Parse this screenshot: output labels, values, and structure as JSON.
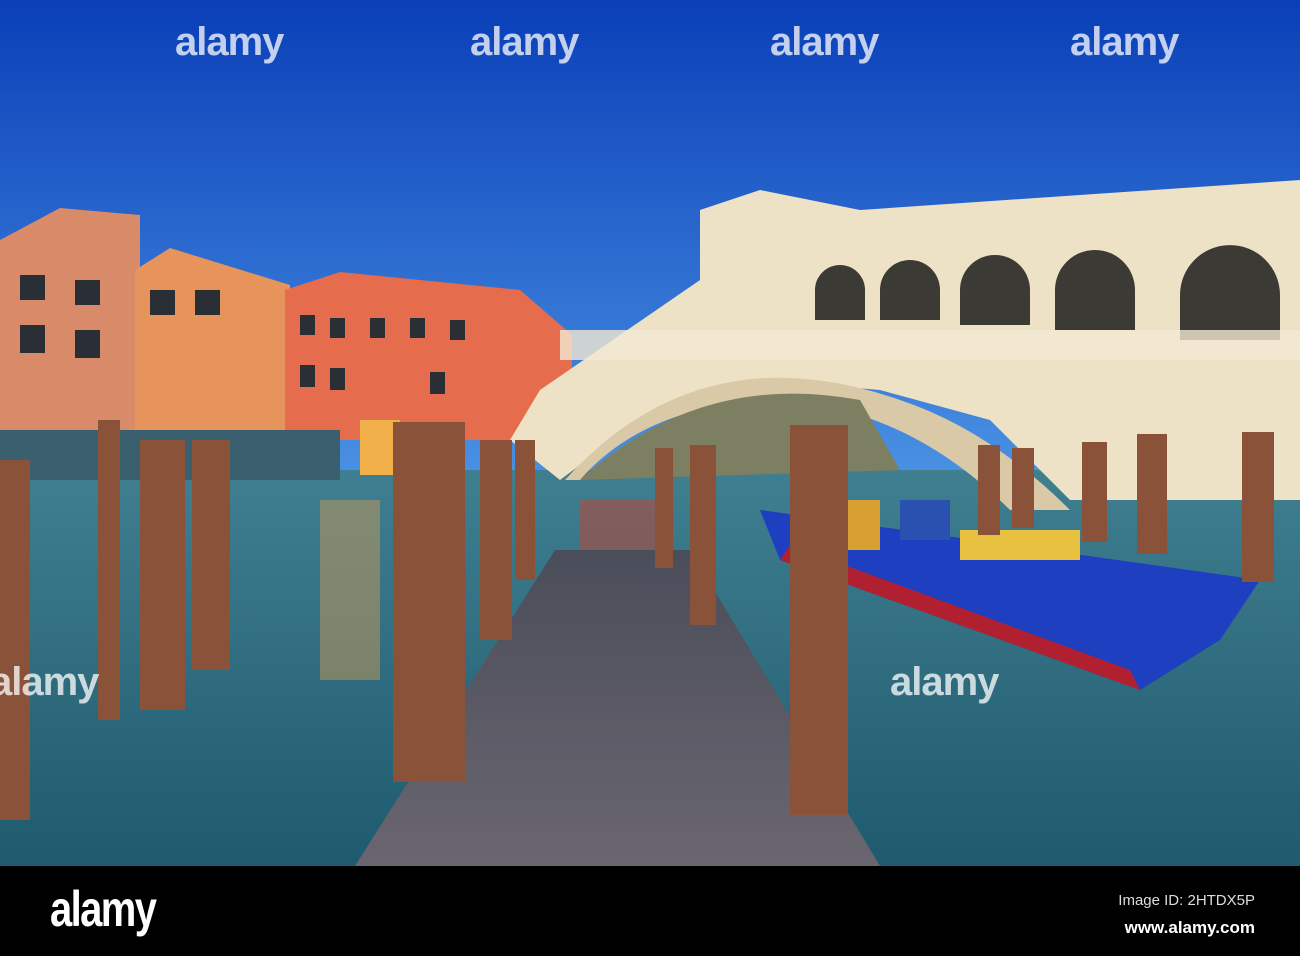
{
  "watermark": "alamy",
  "bottom_bar": {
    "logo": "alamy",
    "image_id": "Image ID: 2HTDX5P",
    "url": "www.alamy.com"
  },
  "colors": {
    "sky_top": "#0a3fb8",
    "sky_bottom": "#3c8ae0",
    "water": "#2f6c80",
    "pier": "#5a5a66",
    "bridge": "#e8dcc4",
    "boat": "#1e3fc0"
  }
}
